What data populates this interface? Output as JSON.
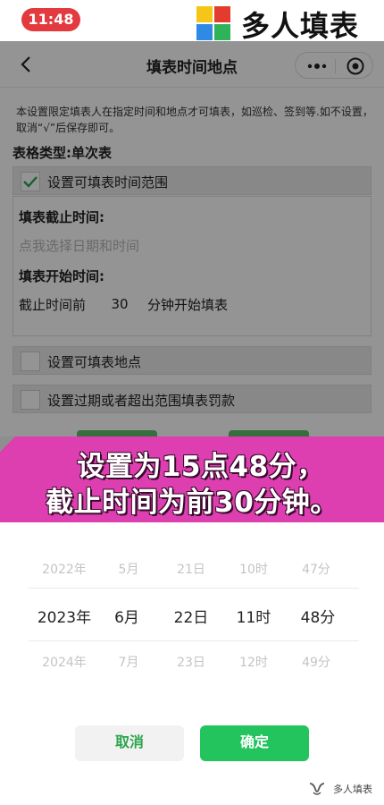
{
  "status_bar": {
    "time": "11:48"
  },
  "brand": {
    "name": "多人填表",
    "logo_colors": [
      "#f5c518",
      "#e33c2f",
      "#2f8ae5",
      "#2fb35a"
    ]
  },
  "navbar": {
    "title": "填表时间地点",
    "back_icon": "chevron-left-icon",
    "more_icon": "more-dots-icon",
    "close_icon": "target-icon"
  },
  "settings": {
    "description": "本设置限定填表人在指定时间和地点才可填表，如巡检、签到等.如不设置，取消“√”后保存即可。",
    "form_type": "表格类型:单次表",
    "time_range": {
      "label": "设置可填表时间范围",
      "checked": true
    },
    "deadline": {
      "label": "填表截止时间:",
      "placeholder": "点我选择日期和时间"
    },
    "start": {
      "label": "填表开始时间:",
      "prefix": "截止时间前",
      "minutes": "30",
      "suffix": "分钟开始填表"
    },
    "location": {
      "label": "设置可填表地点",
      "checked": false
    },
    "penalty": {
      "label": "设置过期或者超出范围填表罚款",
      "checked": false
    }
  },
  "banner": {
    "line1": "设置为15点48分，",
    "line2": "截止时间为前30分钟。"
  },
  "picker": {
    "above": [
      "2022年",
      "5月",
      "21日",
      "10时",
      "47分"
    ],
    "selected": [
      "2023年",
      "6月",
      "22日",
      "11时",
      "48分"
    ],
    "below": [
      "2024年",
      "7月",
      "23日",
      "12时",
      "49分"
    ],
    "cancel_label": "取消",
    "confirm_label": "确定",
    "accent_color": "#23c45e"
  },
  "watermark": {
    "text": "多人填表",
    "icon": "wechat-channel-icon"
  }
}
